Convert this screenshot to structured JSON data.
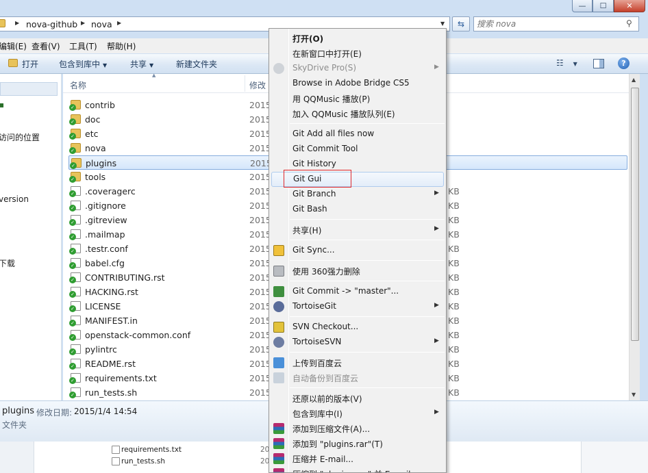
{
  "window": {
    "controls": {
      "minimize": "—",
      "maximize": "☐",
      "close": "✕"
    }
  },
  "address": {
    "crumbs": [
      "nova-github",
      "nova"
    ],
    "search_placeholder": "搜索 nova"
  },
  "menubar": [
    "编辑(E)",
    "查看(V)",
    "工具(T)",
    "帮助(H)"
  ],
  "toolbar": {
    "open": "打开",
    "include_library": "包含到库中",
    "share": "共享",
    "new_folder": "新建文件夹",
    "help": "?"
  },
  "navpane": {
    "items": [
      "访问的位置",
      "version",
      "下载"
    ]
  },
  "filelist": {
    "columns": {
      "name": "名称",
      "modified": "修改"
    },
    "rows": [
      {
        "name": "contrib",
        "type": "folder",
        "date": "2015",
        "size": ""
      },
      {
        "name": "doc",
        "type": "folder",
        "date": "2015",
        "size": ""
      },
      {
        "name": "etc",
        "type": "folder",
        "date": "2015",
        "size": ""
      },
      {
        "name": "nova",
        "type": "folder",
        "date": "2015",
        "size": ""
      },
      {
        "name": "plugins",
        "type": "folder",
        "date": "2015",
        "size": "",
        "selected": true
      },
      {
        "name": "tools",
        "type": "folder",
        "date": "2015",
        "size": ""
      },
      {
        "name": ".coveragerc",
        "type": "file",
        "date": "2015",
        "size": "KB"
      },
      {
        "name": ".gitignore",
        "type": "file",
        "date": "2015",
        "size": "KB"
      },
      {
        "name": ".gitreview",
        "type": "file",
        "date": "2015",
        "size": "KB"
      },
      {
        "name": ".mailmap",
        "type": "file",
        "date": "2015",
        "size": "KB"
      },
      {
        "name": ".testr.conf",
        "type": "file",
        "date": "2015",
        "size": "KB"
      },
      {
        "name": "babel.cfg",
        "type": "file",
        "date": "2015",
        "size": "KB"
      },
      {
        "name": "CONTRIBUTING.rst",
        "type": "file",
        "date": "2015",
        "size": "KB"
      },
      {
        "name": "HACKING.rst",
        "type": "file",
        "date": "2015",
        "size": "KB"
      },
      {
        "name": "LICENSE",
        "type": "file",
        "date": "2015",
        "size": "KB"
      },
      {
        "name": "MANIFEST.in",
        "type": "file",
        "date": "2015",
        "size": "KB"
      },
      {
        "name": "openstack-common.conf",
        "type": "file",
        "date": "2015",
        "size": "KB"
      },
      {
        "name": "pylintrc",
        "type": "file",
        "date": "2015",
        "size": "KB"
      },
      {
        "name": "README.rst",
        "type": "file",
        "date": "2015",
        "size": "KB"
      },
      {
        "name": "requirements.txt",
        "type": "file",
        "date": "2015",
        "size": "KB"
      },
      {
        "name": "run_tests.sh",
        "type": "file",
        "date": "2015",
        "size": "KB"
      }
    ]
  },
  "details": {
    "name": "plugins",
    "modified_label": "修改日期:",
    "modified_value": "2015/1/4 14:54",
    "type": "文件夹"
  },
  "background_window": {
    "rows": [
      {
        "name": "requirements.txt",
        "date": "20"
      },
      {
        "name": "run_tests.sh",
        "date": "20"
      }
    ]
  },
  "context_menu": {
    "groups": [
      [
        {
          "label": "打开(O)",
          "bold": true
        },
        {
          "label": "在新窗口中打开(E)"
        },
        {
          "label": "SkyDrive Pro(S)",
          "disabled": true,
          "submenu": true,
          "icon": "skydrive-icon"
        },
        {
          "label": "Browse in Adobe Bridge CS5"
        },
        {
          "label": "用 QQMusic 播放(P)"
        },
        {
          "label": "加入 QQMusic 播放队列(E)"
        }
      ],
      [
        {
          "label": "Git Add all files now"
        },
        {
          "label": "Git Commit Tool"
        },
        {
          "label": "Git History"
        },
        {
          "label": "Git Gui",
          "highlight": true
        },
        {
          "label": "Git Branch",
          "submenu": true
        },
        {
          "label": "Git Bash"
        }
      ],
      [
        {
          "label": "共享(H)",
          "submenu": true
        }
      ],
      [
        {
          "label": "Git Sync...",
          "icon": "git-sync-icon"
        }
      ],
      [
        {
          "label": "使用 360强力删除",
          "icon": "shredder-icon"
        }
      ],
      [
        {
          "label": "Git Commit -> \"master\"...",
          "icon": "git-commit-icon"
        },
        {
          "label": "TortoiseGit",
          "submenu": true,
          "icon": "tortoisegit-icon"
        }
      ],
      [
        {
          "label": "SVN Checkout...",
          "icon": "svn-checkout-icon"
        },
        {
          "label": "TortoiseSVN",
          "submenu": true,
          "icon": "tortoisesvn-icon"
        }
      ],
      [
        {
          "label": "上传到百度云",
          "icon": "baidu-upload-icon"
        },
        {
          "label": "自动备份到百度云",
          "disabled": true,
          "icon": "baidu-backup-icon"
        }
      ],
      [
        {
          "label": "还原以前的版本(V)"
        },
        {
          "label": "包含到库中(I)",
          "submenu": true
        },
        {
          "label": "添加到压缩文件(A)...",
          "icon": "winrar-icon"
        },
        {
          "label": "添加到 \"plugins.rar\"(T)",
          "icon": "winrar-icon"
        },
        {
          "label": "压缩并 E-mail...",
          "icon": "winrar-icon"
        },
        {
          "label": "压缩到 \"plugins.rar\" 并 E-mail",
          "icon": "winrar-icon"
        }
      ]
    ]
  },
  "colors": {
    "window_frame": "#cfe0f3",
    "selection": "#d5e7fb",
    "highlight_box": "#e0282b",
    "svn_overlay": "#2f9d31"
  }
}
